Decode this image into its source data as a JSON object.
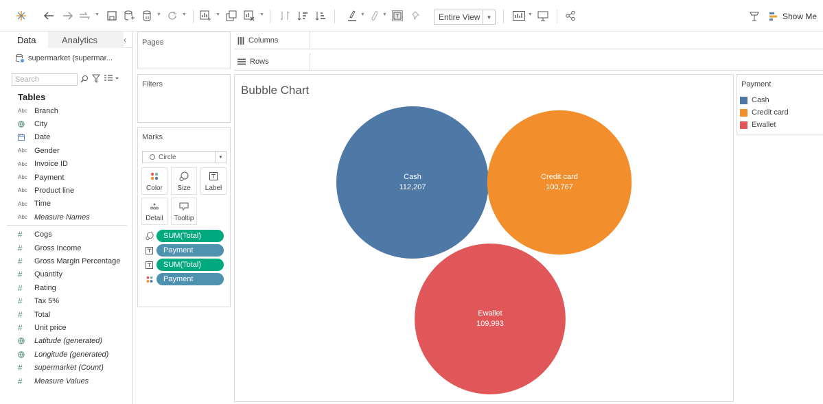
{
  "toolbar": {
    "fit_mode": "Entire View",
    "show_me": "Show Me"
  },
  "data_pane": {
    "tab_data": "Data",
    "tab_analytics": "Analytics",
    "datasource": "supermarket (supermar...",
    "search_placeholder": "Search",
    "tables_heading": "Tables",
    "fields": [
      {
        "type": "Abc",
        "name": "Branch"
      },
      {
        "type": "globe",
        "name": "City"
      },
      {
        "type": "date",
        "name": "Date"
      },
      {
        "type": "Abc",
        "name": "Gender"
      },
      {
        "type": "Abc",
        "name": "Invoice ID"
      },
      {
        "type": "Abc",
        "name": "Payment"
      },
      {
        "type": "Abc",
        "name": "Product line"
      },
      {
        "type": "Abc",
        "name": "Time"
      },
      {
        "type": "Abc",
        "name": "Measure Names",
        "italic": true
      },
      {
        "type": "#",
        "name": "Cogs"
      },
      {
        "type": "#",
        "name": "Gross Income"
      },
      {
        "type": "#",
        "name": "Gross Margin Percentage"
      },
      {
        "type": "#",
        "name": "Quantity"
      },
      {
        "type": "#",
        "name": "Rating"
      },
      {
        "type": "#",
        "name": "Tax 5%"
      },
      {
        "type": "#",
        "name": "Total"
      },
      {
        "type": "#",
        "name": "Unit price"
      },
      {
        "type": "globe",
        "name": "Latitude (generated)",
        "italic": true
      },
      {
        "type": "globe",
        "name": "Longitude (generated)",
        "italic": true
      },
      {
        "type": "#",
        "name": "supermarket (Count)",
        "italic": true
      },
      {
        "type": "#",
        "name": "Measure Values",
        "italic": true
      }
    ]
  },
  "cards": {
    "pages": "Pages",
    "filters": "Filters",
    "marks": "Marks",
    "mark_type": "Circle",
    "buttons": {
      "color": "Color",
      "size": "Size",
      "label": "Label",
      "detail": "Detail",
      "tooltip": "Tooltip"
    },
    "pills": [
      {
        "icon": "size-icon",
        "label": "SUM(Total)",
        "kind": "green"
      },
      {
        "icon": "label-icon",
        "label": "Payment",
        "kind": "blue"
      },
      {
        "icon": "label-icon",
        "label": "SUM(Total)",
        "kind": "green"
      },
      {
        "icon": "color-icon",
        "label": "Payment",
        "kind": "blue"
      }
    ]
  },
  "shelves": {
    "columns": "Columns",
    "rows": "Rows"
  },
  "view": {
    "title": "Bubble Chart"
  },
  "legend": {
    "title": "Payment",
    "items": [
      {
        "label": "Cash",
        "color": "#4e79a7"
      },
      {
        "label": "Credit card",
        "color": "#f28e2b"
      },
      {
        "label": "Ewallet",
        "color": "#e15759"
      }
    ]
  },
  "chart_data": {
    "type": "bubble",
    "title": "Bubble Chart",
    "size_measure": "SUM(Total)",
    "color_dimension": "Payment",
    "points": [
      {
        "label": "Cash",
        "value": 112207,
        "display": "112,207",
        "color": "#4e79a7"
      },
      {
        "label": "Credit card",
        "value": 100767,
        "display": "100,767",
        "color": "#f28e2b"
      },
      {
        "label": "Ewallet",
        "value": 109993,
        "display": "109,993",
        "color": "#e15759"
      }
    ]
  }
}
